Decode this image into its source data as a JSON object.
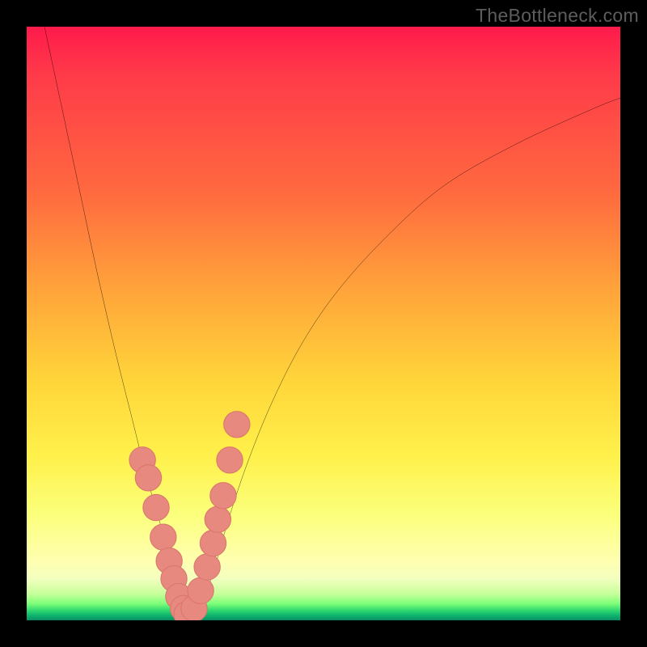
{
  "watermark": "TheBottleneck.com",
  "colors": {
    "frame": "#000000",
    "curve": "#000000",
    "marker_fill": "#e8897f",
    "marker_stroke": "#d9776d"
  },
  "chart_data": {
    "type": "line",
    "title": "",
    "xlabel": "",
    "ylabel": "",
    "xlim": [
      0,
      100
    ],
    "ylim": [
      0,
      100
    ],
    "note": "Plot has no visible axes, ticks, or legend. Background is a vertical rainbow gradient (red top → green bottom). A single black V-shaped curve descends steeply from upper-left, bottoms out near x≈27 at y≈0, and rises with decreasing slope toward the upper right. Pink circular markers cluster near the trough on both branches (approx y ≤ 35 region).",
    "series": [
      {
        "name": "bottleneck-curve",
        "x": [
          3,
          6,
          9,
          12,
          15,
          18,
          20,
          22,
          24,
          26,
          27,
          28,
          30,
          32,
          34,
          37,
          41,
          46,
          52,
          60,
          70,
          82,
          95,
          100
        ],
        "y": [
          100,
          86,
          72,
          58,
          45,
          33,
          25,
          18,
          11,
          4,
          1,
          1,
          4,
          10,
          17,
          26,
          36,
          46,
          55,
          64,
          73,
          80,
          86,
          88
        ]
      }
    ],
    "markers": {
      "name": "highlight-dots",
      "x": [
        19.5,
        20.5,
        21.8,
        23.0,
        24.0,
        24.8,
        25.6,
        26.4,
        27.0,
        28.2,
        29.3,
        30.4,
        31.4,
        32.2,
        33.1,
        34.2,
        35.4
      ],
      "y": [
        27,
        24,
        19,
        14,
        10,
        7,
        4,
        2,
        1,
        2,
        5,
        9,
        13,
        17,
        21,
        27,
        33
      ],
      "r": 2.2
    }
  }
}
